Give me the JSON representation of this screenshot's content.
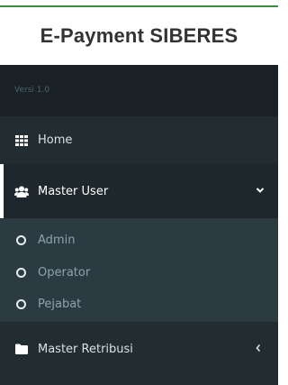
{
  "brand": {
    "title": "E-Payment SIBERES"
  },
  "sidebar": {
    "version": "Versi 1.0",
    "items": [
      {
        "label": "Home",
        "icon": "grid-icon"
      },
      {
        "label": "Master User",
        "icon": "users-icon",
        "expanded": true
      },
      {
        "label": "Master Retribusi",
        "icon": "folder-icon",
        "expanded": false
      }
    ],
    "submenu": [
      {
        "label": "Admin",
        "icon": "circle-outline-icon"
      },
      {
        "label": "Operator",
        "icon": "circle-outline-icon"
      },
      {
        "label": "Pejabat",
        "icon": "circle-outline-icon"
      }
    ]
  },
  "colors": {
    "sidebar_bg": "#222d32",
    "version_bg": "#1a2226",
    "active_bg": "#1e282c",
    "submenu_bg": "#2c3b41",
    "top_line": "#3c8d3c"
  }
}
